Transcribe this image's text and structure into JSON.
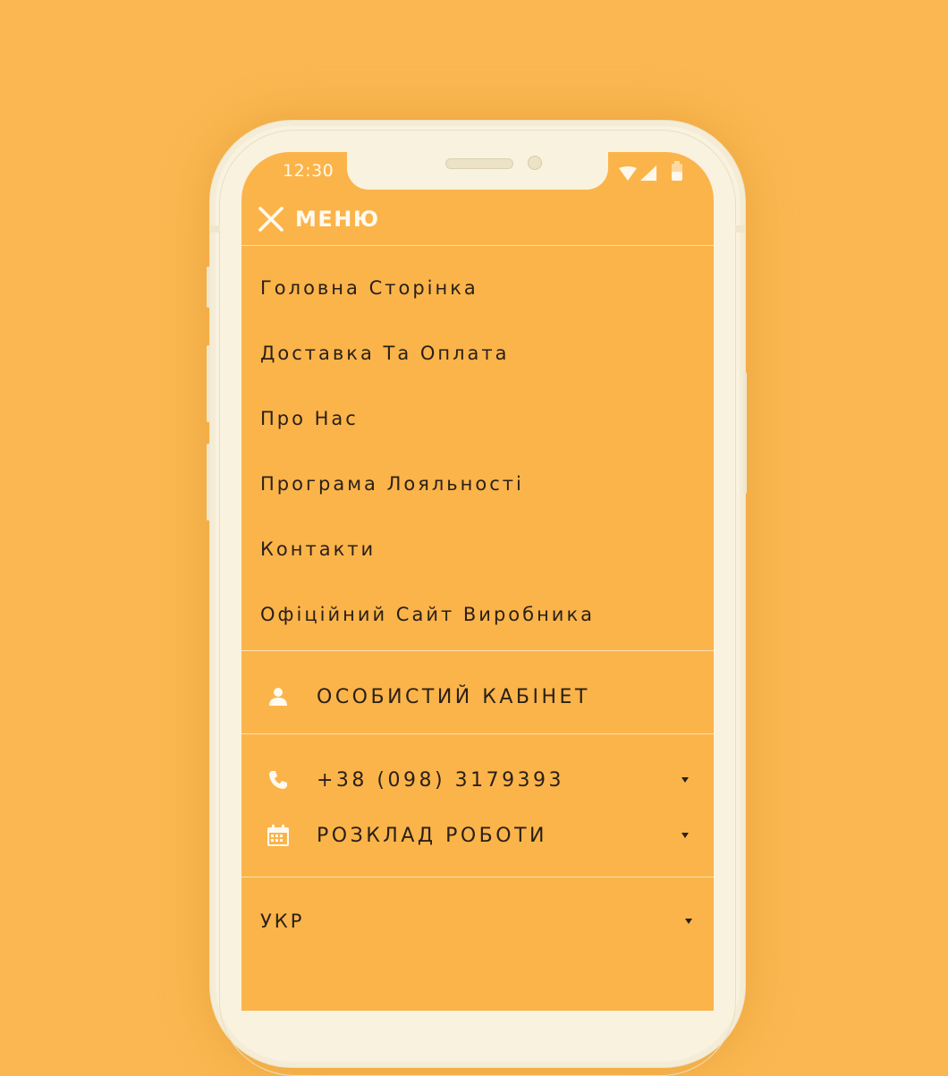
{
  "colors": {
    "background": "#fbb852",
    "screen": "#fbb44a",
    "phone_frame": "#f9f2df",
    "text": "#2a2018",
    "header_text": "#fffaf0"
  },
  "status_bar": {
    "time": "12:30",
    "icons": [
      "wifi-icon",
      "signal-icon",
      "battery-icon"
    ]
  },
  "header": {
    "title": "МЕНЮ",
    "close_icon": "close-icon"
  },
  "nav": {
    "items": [
      {
        "label": "Головна Сторінка"
      },
      {
        "label": "Доставка Та Оплата"
      },
      {
        "label": "Про Нас"
      },
      {
        "label": "Програма Лояльності"
      },
      {
        "label": "Контакти"
      },
      {
        "label": "Офіційний Сайт Виробника"
      }
    ]
  },
  "account": {
    "label": "ОСОБИСТИЙ КАБІНЕТ",
    "icon": "user-icon"
  },
  "contacts": {
    "phone": {
      "label": "+38 (098) 3179393",
      "icon": "phone-icon"
    },
    "schedule": {
      "label": "РОЗКЛАД РОБОТИ",
      "icon": "calendar-icon"
    }
  },
  "language": {
    "selected": "УКР"
  }
}
